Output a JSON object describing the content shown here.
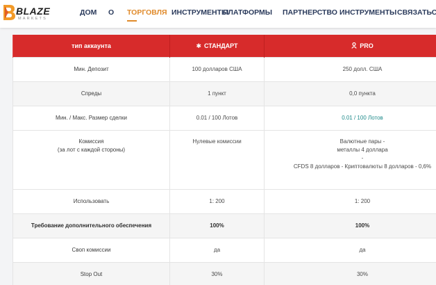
{
  "brand": {
    "name": "BLAZE",
    "sub": "MARKETS",
    "colors": {
      "accent": "#d72b2b",
      "nav_active": "#e08a2a",
      "nav_text": "#2b3b5c",
      "logo_orange": "#f29a28"
    }
  },
  "nav": {
    "items": [
      {
        "label": "ДОМ"
      },
      {
        "label": "О"
      },
      {
        "label": "ТОРГОВЛЯ",
        "active": true
      },
      {
        "label": "ИНСТРУМЕНТЫ"
      },
      {
        "label": "ПЛАТФОРМЫ"
      },
      {
        "label": "ПАРТНЕРСТВО"
      },
      {
        "label": "ИНСТРУМЕНТЫ"
      },
      {
        "label": "СВЯЗАТЬСЯ С"
      }
    ]
  },
  "table": {
    "headers": {
      "type": "тип аккаунта",
      "standard": "СТАНДАРТ",
      "standard_icon": "asterisk-icon",
      "pro": "PRO",
      "pro_icon": "user-icon"
    },
    "rows": [
      {
        "label": "Мин. Депозит",
        "standard": "100 долларов США",
        "pro": "250 долл. США"
      },
      {
        "label": "Спреды",
        "standard": "1 пункт",
        "pro": "0,0 пункта"
      },
      {
        "label": "Мин. / Макс. Размер сделки",
        "standard": "0.01 / 100 Лотов",
        "pro": "0.01 / 100 Лотов"
      },
      {
        "label_line1": "Комиссия",
        "label_line2": "(за лот с каждой стороны)",
        "standard": "Нулевые комиссии",
        "pro_line1": "Валютные пары -",
        "pro_line2": "металлы 4 доллара",
        "pro_line3": "-",
        "pro_line4": "CFDS 8 долларов - Криптовалюты 8 долларов - 0,6%"
      },
      {
        "label": "Использовать",
        "standard": "1: 200",
        "pro": "1: 200"
      },
      {
        "label": "Требование дополнительного обеспечения",
        "standard": "100%",
        "pro": "100%"
      },
      {
        "label": "Своп комиссии",
        "standard": "да",
        "pro": "да"
      },
      {
        "label": "Stop Out",
        "standard": "30%",
        "pro": "30%"
      }
    ]
  }
}
